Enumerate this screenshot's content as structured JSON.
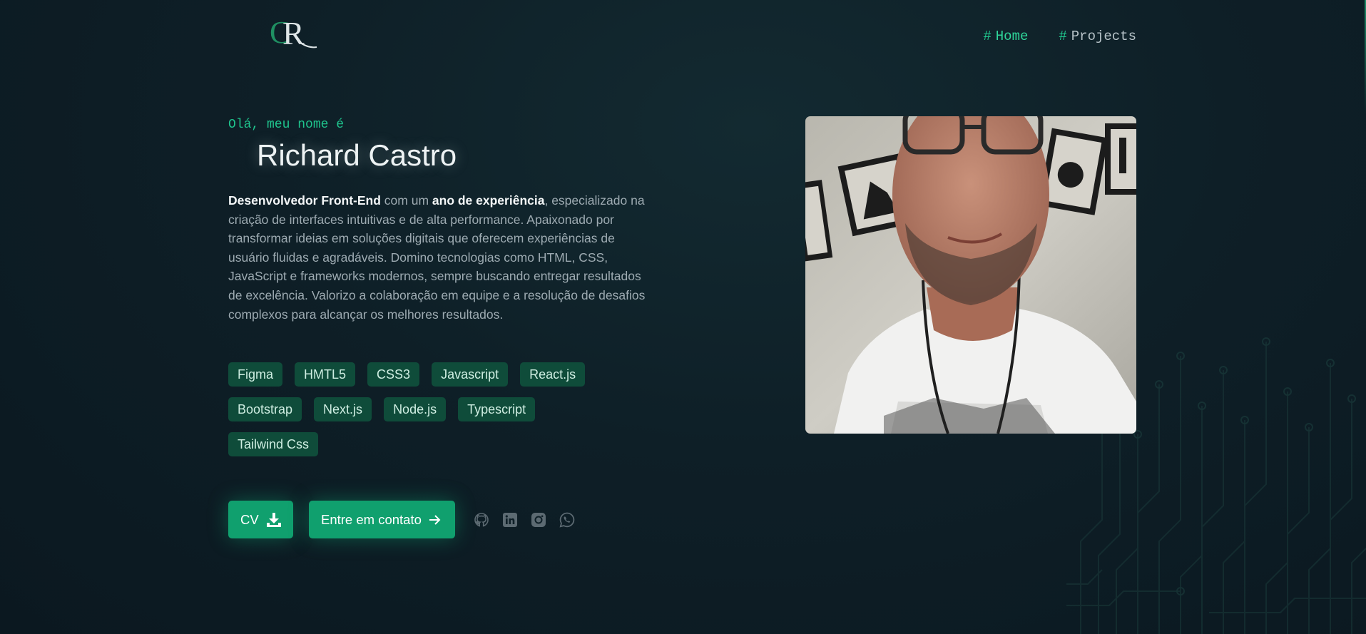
{
  "header": {
    "logo_text": "CR",
    "nav": [
      {
        "hash": "#",
        "label": "Home"
      },
      {
        "hash": "#",
        "label": "Projects"
      }
    ]
  },
  "hero": {
    "greeting": "Olá, meu nome é",
    "name": "Richard Castro",
    "bio": {
      "role": "Desenvolvedor Front-End",
      "connector": " com um ",
      "experience": "ano de experiência",
      "rest": ", especializado na criação de interfaces intuitivas e de alta performance. Apaixonado por transformar ideias em soluções digitais que oferecem experiências de usuário fluidas e agradáveis. Domino tecnologias como HTML, CSS, JavaScript e frameworks modernos, sempre buscando entregar resultados de excelência. Valorizo a colaboração em equipe e a resolução de desafios complexos para alcançar os melhores resultados."
    },
    "skills": [
      "Figma",
      "HMTL5",
      "CSS3",
      "Javascript",
      "React.js",
      "Bootstrap",
      "Next.js",
      "Node.js",
      "Typescript",
      "Tailwind Css"
    ],
    "buttons": {
      "cv_label": "CV",
      "contact_label": "Entre em contato"
    },
    "socials": [
      "github-icon",
      "linkedin-icon",
      "instagram-icon",
      "whatsapp-icon"
    ]
  },
  "colors": {
    "background": "#0d1b22",
    "accent": "#10a06e",
    "tag_bg": "#0f4c3a",
    "greeting": "#1fc48d"
  }
}
